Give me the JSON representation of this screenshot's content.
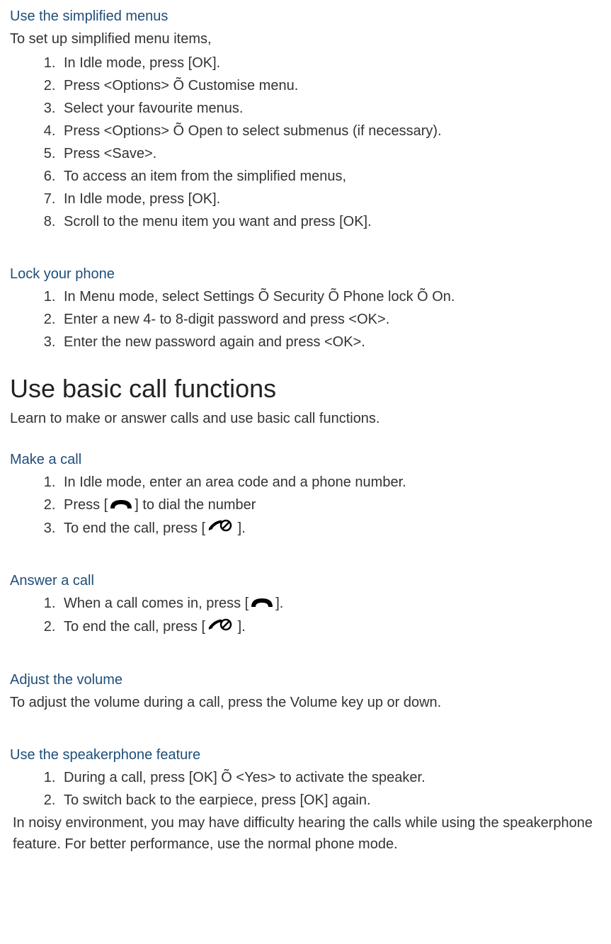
{
  "sections": {
    "simplified_menus": {
      "title": "Use the simplified menus",
      "intro": "To set up simplified menu items,",
      "steps": [
        "In Idle mode, press [OK].",
        "Press <Options> Õ Customise menu.",
        "Select your favourite menus.",
        "Press <Options> Õ Open to select submenus (if necessary).",
        "Press <Save>.",
        "To access an item from the simplified menus,",
        "In Idle mode, press [OK].",
        "Scroll to the menu item you want and press [OK]."
      ]
    },
    "lock_phone": {
      "title": "Lock your phone",
      "steps": [
        "In Menu mode, select Settings Õ Security Õ Phone lock Õ On.",
        "Enter a new 4- to 8-digit password and press <OK>.",
        "Enter the new password again and press <OK>."
      ]
    },
    "basic_calls": {
      "heading": "Use basic call functions",
      "intro": "Learn to make or answer calls and use basic call functions."
    },
    "make_call": {
      "title": "Make a call",
      "step1": "In Idle mode, enter an area code and a phone number.",
      "step2_pre": "Press [",
      "step2_post": "] to dial the number",
      "step3_pre": "To end the call, press [",
      "step3_post": " ]."
    },
    "answer_call": {
      "title": "Answer a call",
      "step1_pre": "When a call comes in, press [",
      "step1_post": "].",
      "step2_pre": "To end the call, press [",
      "step2_post": " ]."
    },
    "adjust_volume": {
      "title": "Adjust the volume",
      "text": "To adjust the volume during a call, press the Volume key up or down."
    },
    "speakerphone": {
      "title": "Use the speakerphone feature",
      "steps": [
        "During a call, press [OK] Õ <Yes> to activate the speaker.",
        "To switch back to the earpiece, press [OK] again."
      ],
      "note": "In noisy environment, you may have difficulty hearing the calls while using the speakerphone feature. For better performance, use the normal phone mode."
    }
  }
}
